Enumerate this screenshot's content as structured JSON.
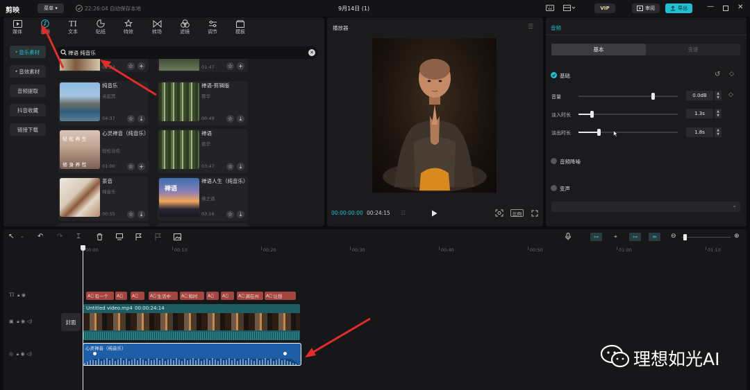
{
  "topbar": {
    "logo": "剪映",
    "menu": "菜单",
    "autosave": "22:26:04 自动保存本地",
    "project": "9月14日 (1)",
    "vip": "VIP",
    "review": "审阅",
    "export": "导出"
  },
  "material_tabs": [
    {
      "label": "媒体",
      "icon": "media-icon"
    },
    {
      "label": "音频",
      "icon": "audio-icon"
    },
    {
      "label": "文本",
      "icon": "text-icon"
    },
    {
      "label": "贴纸",
      "icon": "sticker-icon"
    },
    {
      "label": "特效",
      "icon": "effects-icon"
    },
    {
      "label": "转场",
      "icon": "transition-icon"
    },
    {
      "label": "滤镜",
      "icon": "filter-icon"
    },
    {
      "label": "调节",
      "icon": "adjust-icon"
    },
    {
      "label": "模板",
      "icon": "template-icon"
    }
  ],
  "side_nav": [
    "音乐素材",
    "音效素材",
    "音频提取",
    "抖音收藏",
    "链接下载"
  ],
  "search": {
    "value": "禅语 纯音乐"
  },
  "partial_durations": [
    "02:22",
    "01:47"
  ],
  "cards": [
    {
      "title": "纯音乐",
      "sub": "关宏宾",
      "dur": "04:37"
    },
    {
      "title": "禅语-剪辑版",
      "sub": "晋华",
      "dur": "00:49"
    },
    {
      "title": "心灵禅音（纯音乐）",
      "sub": "轻松治愈",
      "dur": "01:00"
    },
    {
      "title": "禅语",
      "sub": "晋华",
      "dur": "03:47"
    },
    {
      "title": "茶音",
      "sub": "纯音乐",
      "dur": "00:55"
    },
    {
      "title": "禅语人生（纯音乐）",
      "sub": "佛之道",
      "dur": "03:16"
    }
  ],
  "thumb_text": {
    "c3_top": "轻 松 养 生",
    "c3_bottom": "修 身 养 性",
    "c6_text": "禅语"
  },
  "player": {
    "title": "播放器",
    "current": "00:00:00:00",
    "total": "00:24:15",
    "ratio": "比例"
  },
  "audio_panel": {
    "title": "音频",
    "tab_basic": "基本",
    "tab_speed": "变速",
    "section_basic": "基础",
    "volume_label": "音量",
    "volume_value": "0.0dB",
    "volume_level": 0.75,
    "fadein_label": "淡入时长",
    "fadein_value": "1.3s",
    "fadein_level": 0.13,
    "fadeout_label": "淡出时长",
    "fadeout_value": "1.8s",
    "fadeout_level": 0.2,
    "noise": "音频降噪",
    "voice_change": "变声"
  },
  "timeline": {
    "ticks": [
      "00:00",
      "00:10",
      "00:20",
      "00:30",
      "00:40",
      "00:50",
      "01:00",
      "01:10"
    ],
    "text_chips": [
      "有一个",
      "",
      "",
      "生活中",
      "和时",
      "",
      "",
      "满在州",
      "让想"
    ],
    "video_label": "Untitled video.mp4",
    "video_dur": "00:00:24:14",
    "cover": "封面",
    "audio_label": "心灵禅音（纯音乐）"
  },
  "watermark": "理想如光AI",
  "colors": {
    "accent": "#1fc1d0",
    "arrow": "#e32b2b",
    "chip": "#a4453f",
    "video_track": "#1d5c61",
    "audio_track": "#1e5ea6"
  }
}
